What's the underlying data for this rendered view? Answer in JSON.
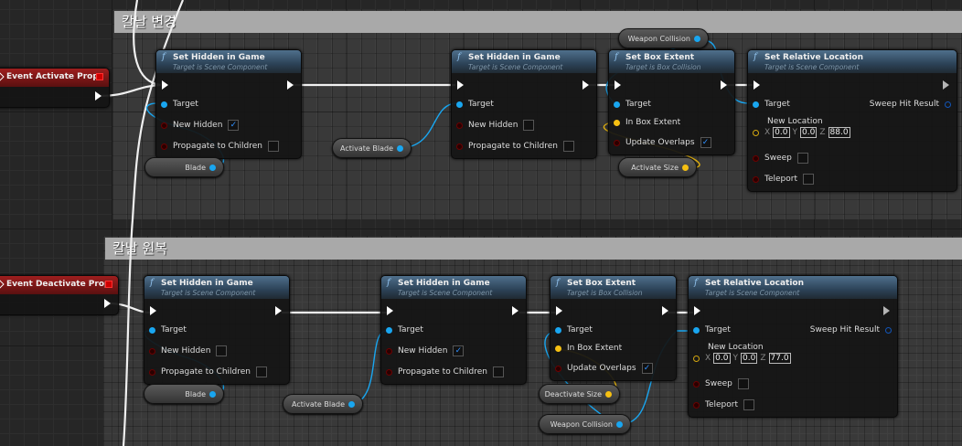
{
  "comments": [
    {
      "title": "칼날 변경"
    },
    {
      "title": "칼날 원복"
    }
  ],
  "events": [
    {
      "title": "Event Activate Prop"
    },
    {
      "title": "Event Deactivate Prop"
    }
  ],
  "labels": {
    "set_hidden": "Set Hidden in Game",
    "set_hidden_sub": "Target is Scene Component",
    "set_box": "Set Box Extent",
    "set_box_sub": "Target is Box Collision",
    "set_rel": "Set Relative Location",
    "set_rel_sub": "Target is Scene Component",
    "target": "Target",
    "new_hidden": "New Hidden",
    "propagate": "Propagate to Children",
    "in_box_extent": "In Box Extent",
    "update_overlaps": "Update Overlaps",
    "new_location": "New Location",
    "sweep": "Sweep",
    "teleport": "Teleport",
    "sweep_hit": "Sweep Hit Result",
    "x": "X",
    "y": "Y",
    "z": "Z"
  },
  "top": {
    "hidden1_new_hidden": true,
    "hidden1_propagate": false,
    "hidden2_new_hidden": false,
    "hidden2_propagate": false,
    "box_update_overlaps": true,
    "location": {
      "x": "0.0",
      "y": "0.0",
      "z": "88.0"
    },
    "sweep": false,
    "teleport": false,
    "vars": {
      "blade": "Blade",
      "activate_blade": "Activate Blade",
      "weapon_collision": "Weapon Collision",
      "size": "Activate Size"
    }
  },
  "bottom": {
    "hidden1_new_hidden": false,
    "hidden1_propagate": false,
    "hidden2_new_hidden": true,
    "hidden2_propagate": false,
    "box_update_overlaps": true,
    "location": {
      "x": "0.0",
      "y": "0.0",
      "z": "77.0"
    },
    "sweep": false,
    "teleport": false,
    "vars": {
      "blade": "Blade",
      "activate_blade": "Activate Blade",
      "weapon_collision": "Weapon Collision",
      "size": "Deactivate Size"
    }
  },
  "colors": {
    "object_pin": "#19a6f0",
    "vector_pin": "#f6c012",
    "bool_pin": "#6b0000",
    "event_header": "#9e1e1e",
    "function_header": "#3c5670"
  }
}
